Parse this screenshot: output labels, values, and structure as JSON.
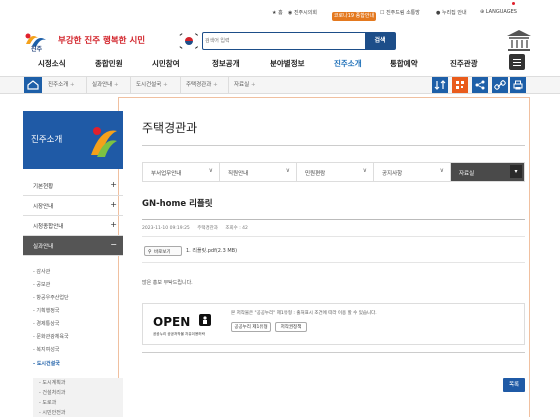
{
  "topbar": {
    "home": "홈",
    "city_council": "진주시의회",
    "covid": "코로나19 종합안내",
    "hub": "진주드림 소통방",
    "sitemap": "누리집 안내",
    "languages": "LANGUAGES"
  },
  "header": {
    "slogan": "부강한 진주 행복한 시민",
    "search_placeholder": "검색어 입력",
    "search_button": "검색"
  },
  "gnb": [
    {
      "label": "시정소식"
    },
    {
      "label": "종합민원"
    },
    {
      "label": "시민참여"
    },
    {
      "label": "정보공개"
    },
    {
      "label": "분야별정보"
    },
    {
      "label": "진주소개"
    },
    {
      "label": "통합예약"
    },
    {
      "label": "진주관광"
    }
  ],
  "breadcrumb": [
    {
      "label": "진주소개"
    },
    {
      "label": "실과안내"
    },
    {
      "label": "도시건설국"
    },
    {
      "label": "주택경관과"
    },
    {
      "label": "자료실"
    }
  ],
  "utility_colors": [
    "#1d5fa8",
    "#e95b1b",
    "#1d5fa8",
    "#1d5fa8",
    "#1d5fa8"
  ],
  "sidebar": {
    "title": "진주소개",
    "menus": [
      {
        "label": "기본현황",
        "sym": "+"
      },
      {
        "label": "시장안내",
        "sym": "+"
      },
      {
        "label": "시청종합안내",
        "sym": "+"
      },
      {
        "label": "실과안내",
        "sym": "−"
      }
    ],
    "subs": [
      {
        "label": "- 감사관"
      },
      {
        "label": "- 공보관"
      },
      {
        "label": "- 항공우주산업단"
      },
      {
        "label": "- 기획행정국"
      },
      {
        "label": "- 경제통상국"
      },
      {
        "label": "- 문화관광체육국"
      },
      {
        "label": "- 복지여성국"
      },
      {
        "label": "- 도시건설국"
      }
    ],
    "subs2": [
      {
        "label": "- 도시계획과"
      },
      {
        "label": "- 건설처리과"
      },
      {
        "label": "- 도로과"
      },
      {
        "label": "- 시민안전과"
      }
    ]
  },
  "page_title": "주택경관과",
  "tabs": [
    {
      "label": "부서업무안내",
      "arrow": "∨"
    },
    {
      "label": "직원안내",
      "arrow": "∨"
    },
    {
      "label": "민원편람",
      "arrow": "∨"
    },
    {
      "label": "공지사항",
      "arrow": "∨"
    },
    {
      "label": "자료실",
      "arrow": "▾"
    }
  ],
  "article": {
    "title": "GN-home 리플릿",
    "date": "2023-11-10 09:19:25",
    "department": "주택경관과",
    "views": "조회수 : 42",
    "view_button": "바로보기",
    "file": "1. 리플릿.pdf(2.3 MB)",
    "body": "많은 홍보 부탁드립니다."
  },
  "license": {
    "logo_text": "OPEN",
    "logo_sub": "공공누리  공공저작물 자유이용허락",
    "text": "본 저작물은 \"공공누리\" 제1유형 : 출처표시 조건에 따라 이용 할 수 있습니다.",
    "btn1": "공공누리 제1유형",
    "btn2": "저작권정책"
  },
  "list_button": "목록"
}
